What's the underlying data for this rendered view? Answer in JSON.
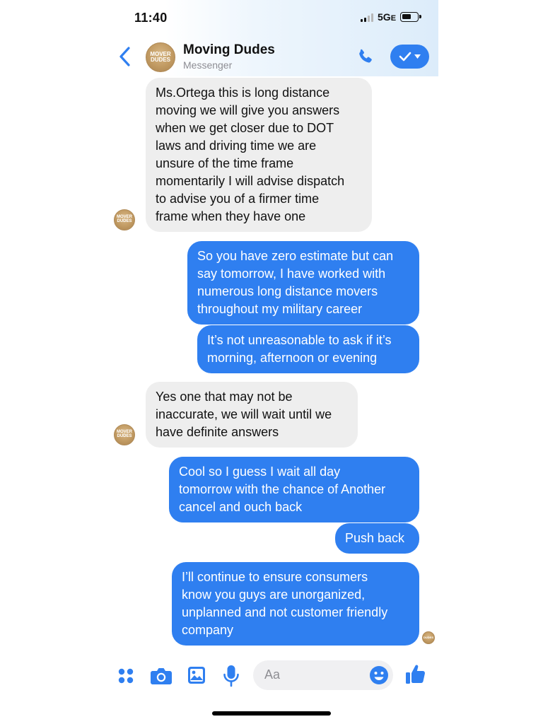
{
  "status_bar": {
    "time": "11:40",
    "network": "5G",
    "network_suffix": "E"
  },
  "header": {
    "contact_name": "Moving Dudes",
    "subtitle": "Messenger",
    "avatar_text": "MOVER DUDES"
  },
  "messages": [
    {
      "sender": "Moving Dudes",
      "direction": "incoming",
      "text": "Ms.Ortega this is long distance\nmoving we will give you answers\nwhen we get closer due to DOT\nlaws and driving time we are\nunsure of the time frame\nmomentarily I will advise dispatch\nto advise you of a firmer time\nframe when they have one"
    },
    {
      "sender": "me",
      "direction": "outgoing",
      "text": "So you have zero estimate but can\nsay tomorrow, I have worked with\nnumerous long distance movers\nthroughout my military career"
    },
    {
      "sender": "me",
      "direction": "outgoing",
      "text": "It’s not unreasonable to ask if it’s\nmorning, afternoon or evening"
    },
    {
      "sender": "Moving Dudes",
      "direction": "incoming",
      "text": "Yes one that may not be\ninaccurate, we will wait until we\nhave  definite answers"
    },
    {
      "sender": "me",
      "direction": "outgoing",
      "text": "Cool so I guess I wait all day\ntomorrow with the chance of Another\ncancel and ouch back"
    },
    {
      "sender": "me",
      "direction": "outgoing",
      "text": "Push back"
    },
    {
      "sender": "me",
      "direction": "outgoing",
      "text": "I’ll continue to ensure consumers\nknow you guys are unorganized,\nunplanned and not customer friendly\ncompany"
    }
  ],
  "composer": {
    "placeholder": "Aa"
  },
  "icons": {
    "back": "chevron-left-icon",
    "call": "phone-icon",
    "check": "check-dropdown-icon",
    "menu": "grid-dots-icon",
    "camera": "camera-icon",
    "gallery": "image-icon",
    "mic": "microphone-icon",
    "emoji": "emoji-icon",
    "like": "thumbs-up-icon"
  },
  "colors": {
    "accent": "#2f7ff0",
    "incoming_bubble": "#eeeeee",
    "outgoing_text": "#ffffff"
  }
}
